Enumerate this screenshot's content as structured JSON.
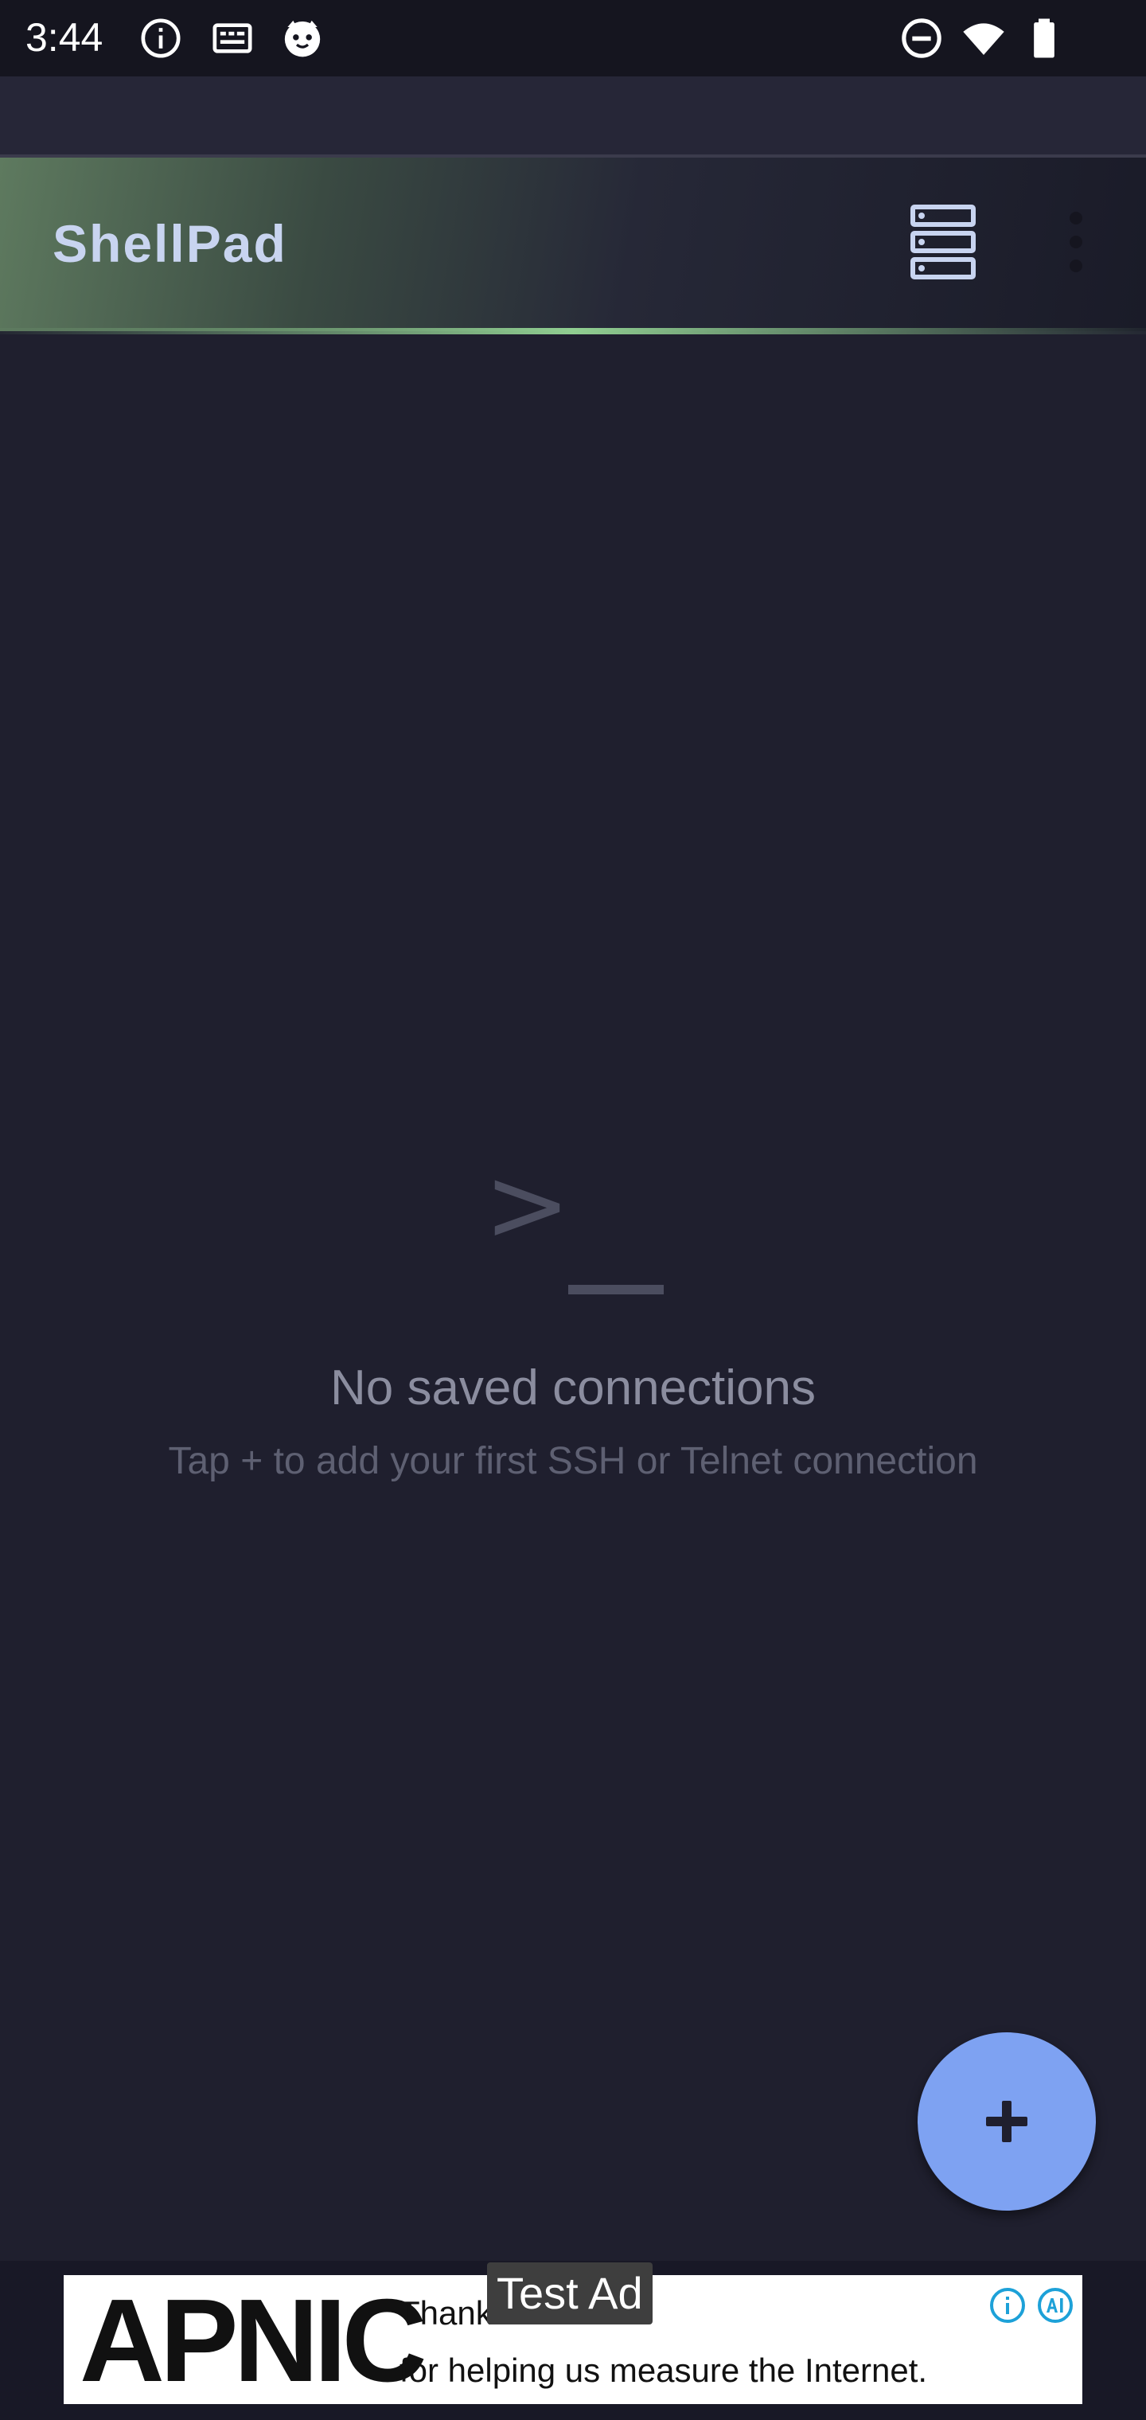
{
  "status_bar": {
    "time": "3:44",
    "icons": [
      "info-icon",
      "keyboard-icon",
      "cat-face-icon",
      "do-not-disturb-icon",
      "wifi-icon",
      "battery-icon"
    ]
  },
  "app_bar": {
    "title": "ShellPad",
    "actions": [
      "list-view-icon",
      "more-vert-icon"
    ]
  },
  "empty_state": {
    "glyph_prompt": ">",
    "title": "No saved connections",
    "subtitle": "Tap + to add your first SSH or Telnet connection"
  },
  "fab": {
    "icon": "plus-icon"
  },
  "ad": {
    "brand": "APNIC",
    "line1": "Thank",
    "line2": "for helping us measure the Internet.",
    "test_label": "Test Ad"
  },
  "colors": {
    "background": "#1f1f2e",
    "title_text": "#c8d4f0",
    "fab": "#7ea2f2",
    "accent_glow": "#96d796"
  }
}
